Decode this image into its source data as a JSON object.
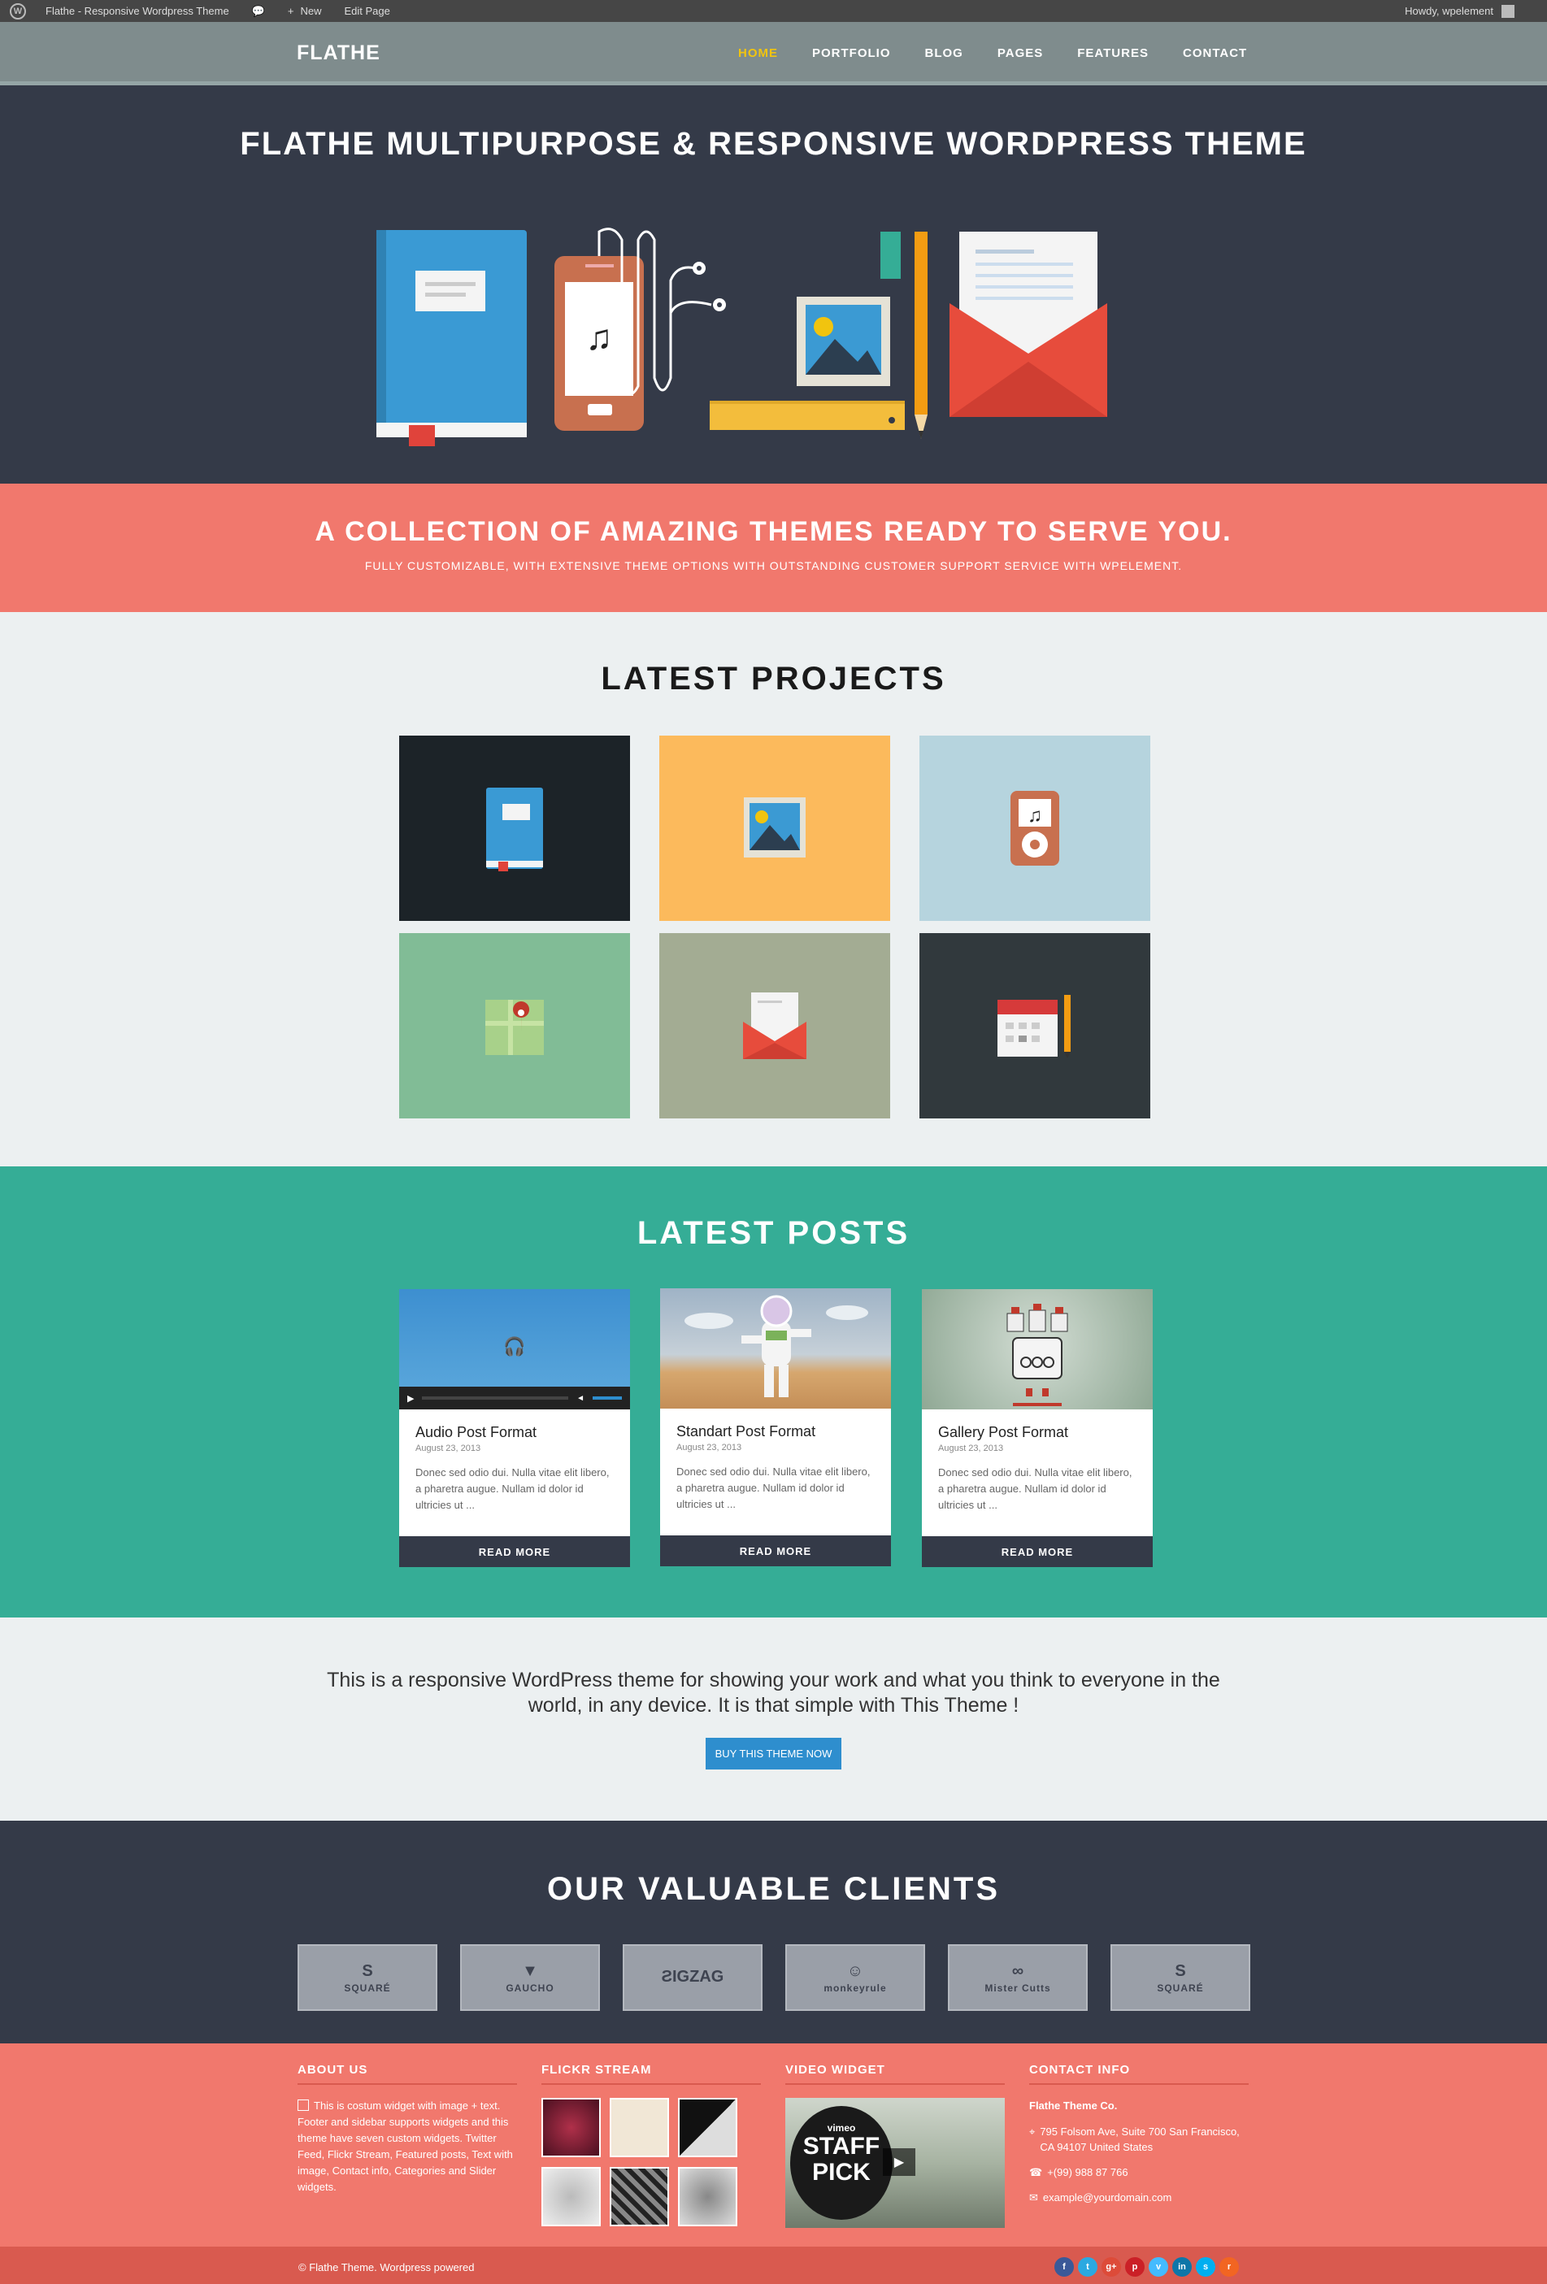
{
  "adminbar": {
    "site_title": "Flathe - Responsive Wordpress Theme",
    "new_label": "New",
    "edit_label": "Edit Page",
    "howdy": "Howdy, wpelement"
  },
  "nav": {
    "logo": "FLATHE",
    "items": [
      {
        "label": "HOME",
        "active": true
      },
      {
        "label": "PORTFOLIO"
      },
      {
        "label": "BLOG"
      },
      {
        "label": "PAGES"
      },
      {
        "label": "FEATURES"
      },
      {
        "label": "CONTACT"
      }
    ]
  },
  "hero": {
    "title": "FLATHE MULTIPURPOSE & RESPONSIVE WORDPRESS THEME"
  },
  "tagline": {
    "title": "A COLLECTION OF AMAZING THEMES READY TO SERVE YOU.",
    "subtitle": "FULLY CUSTOMIZABLE, WITH EXTENSIVE THEME OPTIONS WITH OUTSTANDING CUSTOMER SUPPORT SERVICE WITH WPELEMENT."
  },
  "projects": {
    "title": "LATEST PROJECTS",
    "tiles": [
      {
        "name": "book",
        "bg": "#1c2328"
      },
      {
        "name": "picture",
        "bg": "#fcba5c"
      },
      {
        "name": "music-player",
        "bg": "#b6d4de"
      },
      {
        "name": "map",
        "bg": "#81bc96"
      },
      {
        "name": "envelope",
        "bg": "#a3ac93"
      },
      {
        "name": "calendar",
        "bg": "#31393d"
      }
    ]
  },
  "posts": {
    "title": "LATEST POSTS",
    "read_more": "READ MORE",
    "items": [
      {
        "title": "Audio Post Format",
        "date": "August 23, 2013",
        "excerpt": "Donec sed odio dui. Nulla vitae elit libero, a pharetra augue. Nullam id dolor id ultricies ut ..."
      },
      {
        "title": "Standart Post Format",
        "date": "August 23, 2013",
        "excerpt": "Donec sed odio dui. Nulla vitae elit libero, a pharetra augue. Nullam id dolor id ultricies ut ..."
      },
      {
        "title": "Gallery Post Format",
        "date": "August 23, 2013",
        "excerpt": "Donec sed odio dui. Nulla vitae elit libero, a pharetra augue. Nullam id dolor id ultricies ut ..."
      }
    ]
  },
  "cta": {
    "text": "This is a responsive WordPress theme for showing your work and what you think to everyone in the world, in any device. It is that simple with This Theme !",
    "button": "BUY THIS THEME NOW"
  },
  "clients": {
    "title": "OUR VALUABLE CLIENTS",
    "logos": [
      {
        "mark": "S",
        "sub": "SQUARÉ"
      },
      {
        "mark": "▼",
        "sub": "GAUCHO"
      },
      {
        "mark": "ƧIGZAG",
        "sub": ""
      },
      {
        "mark": "☺",
        "sub": "monkeyrule"
      },
      {
        "mark": "∞",
        "sub": "Mister Cutts"
      },
      {
        "mark": "S",
        "sub": "SQUARÉ"
      }
    ]
  },
  "footer": {
    "about": {
      "heading": "ABOUT US",
      "text": "This is costum widget with image + text. Footer and sidebar supports widgets and this theme have seven custom widgets. Twitter Feed, Flickr Stream, Featured posts, Text with image, Contact info, Categories and Slider widgets."
    },
    "flickr": {
      "heading": "FLICKR STREAM"
    },
    "video": {
      "heading": "VIDEO WIDGET",
      "badge_top": "vimeo",
      "badge_line1": "STAFF",
      "badge_line2": "PICK"
    },
    "contact": {
      "heading": "CONTACT INFO",
      "company": "Flathe Theme Co.",
      "address": "795 Folsom Ave, Suite 700 San Francisco, CA 94107 United States",
      "phone": "+(99) 988 87 766",
      "email": "example@yourdomain.com"
    },
    "copyright": "© Flathe Theme. Wordpress powered",
    "social": [
      {
        "icon": "facebook-icon",
        "glyph": "f",
        "color": "#3b5998"
      },
      {
        "icon": "twitter-icon",
        "glyph": "t",
        "color": "#2ba9e1"
      },
      {
        "icon": "google-plus-icon",
        "glyph": "g+",
        "color": "#dd4b39"
      },
      {
        "icon": "pinterest-icon",
        "glyph": "p",
        "color": "#cb2027"
      },
      {
        "icon": "vimeo-icon",
        "glyph": "v",
        "color": "#44bbff"
      },
      {
        "icon": "linkedin-icon",
        "glyph": "in",
        "color": "#0e76a8"
      },
      {
        "icon": "skype-icon",
        "glyph": "s",
        "color": "#00aff0"
      },
      {
        "icon": "rss-icon",
        "glyph": "r",
        "color": "#f26522"
      }
    ]
  }
}
